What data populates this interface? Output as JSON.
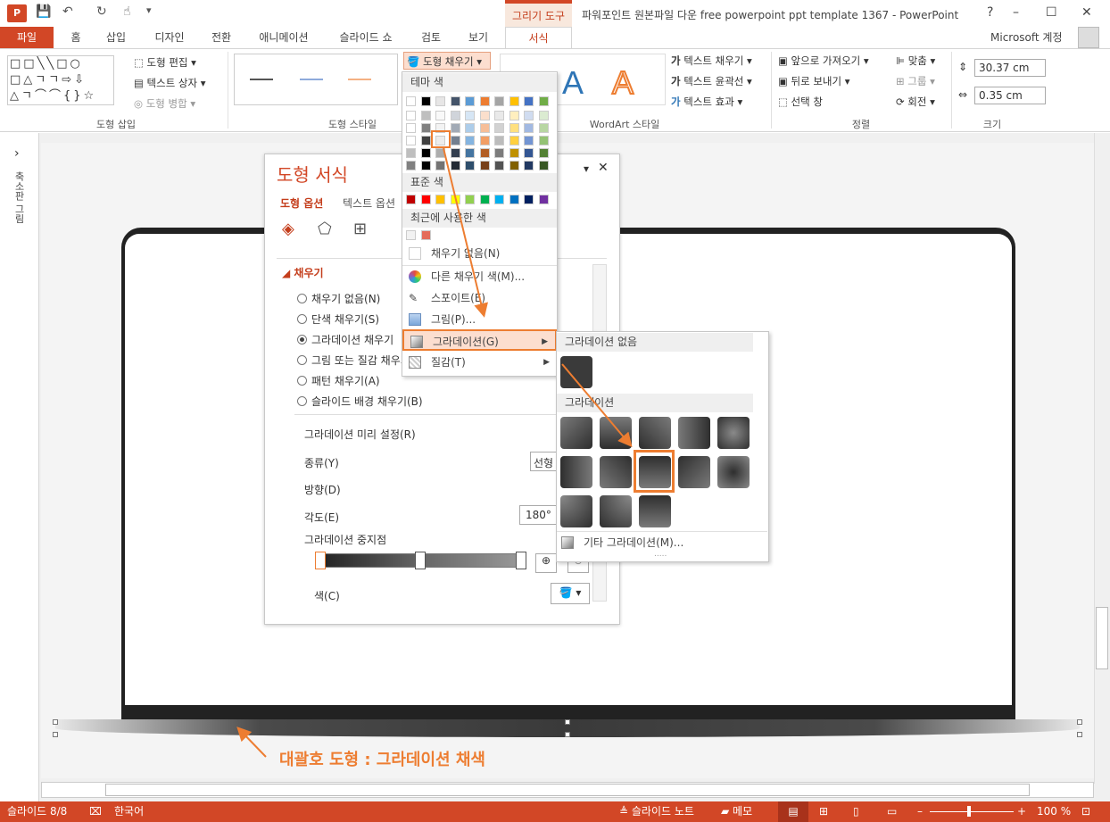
{
  "window": {
    "doc_title": "파워포인트 원본파일 다운 free powerpoint ppt template 1367 - PowerPoint",
    "context_tab": "그리기 도구",
    "help": "?",
    "minimize": "–",
    "restore": "☐",
    "close": "✕"
  },
  "qat": {
    "logo": "P",
    "save": "💾",
    "undo": "↶",
    "redo": "↻",
    "touch": "☝",
    "more": "▾"
  },
  "tabs": [
    "파일",
    "홈",
    "삽입",
    "디자인",
    "전환",
    "애니메이션",
    "슬라이드 쇼",
    "검토",
    "보기",
    "서식"
  ],
  "account": "Microsoft 계정",
  "ribbon": {
    "shapes_glyphs": "□□╲╲□○\n□△ㄱㄱ⇨⇩\n△ㄱ⌒⌒{}☆",
    "edit_shape": "도형 편집",
    "text_box": "텍스트 상자",
    "merge_shapes": "도형 병합",
    "group_insert": "도형 삽입",
    "group_style": "도형 스타일",
    "shape_fill": "도형 채우기",
    "text_fill": "텍스트 채우기",
    "text_outline": "텍스트 윤곽선",
    "text_effect": "텍스트 효과",
    "wordart_A": "A",
    "group_wordart": "WordArt 스타일",
    "bring_forward": "앞으로 가져오기",
    "send_backward": "뒤로 보내기",
    "selection_pane": "선택 창",
    "align": "맞춤",
    "group": "그룹",
    "rotate": "회전",
    "group_arrange": "정렬",
    "height": "30.37 cm",
    "width": "0.35 cm",
    "group_size": "크기"
  },
  "left_pane": {
    "label": "축소판 그림",
    "toggle": "›"
  },
  "format_pane": {
    "title": "도형 서식",
    "tab_shape": "도형 옵션",
    "tab_text": "텍스트 옵션",
    "section": "채우기",
    "options": [
      {
        "label": "채우기 없음(N)",
        "on": false
      },
      {
        "label": "단색 채우기(S)",
        "on": false
      },
      {
        "label": "그라데이션 채우기",
        "on": true
      },
      {
        "label": "그림 또는 질감 채우기",
        "on": false
      },
      {
        "label": "패턴 채우기(A)",
        "on": false
      },
      {
        "label": "슬라이드 배경 채우기(B)",
        "on": false
      }
    ],
    "preset_label": "그라데이션 미리 설정(R)",
    "type_label": "종류(Y)",
    "type_value": "선형",
    "direction_label": "방향(D)",
    "angle_label": "각도(E)",
    "angle_value": "180°",
    "stops_label": "그라데이션 중지점",
    "color_label": "색(C)"
  },
  "fill_menu": {
    "theme_colors": "테마 색",
    "standard_colors": "표준 색",
    "recent_colors": "최근에 사용한 색",
    "no_fill": "채우기 없음(N)",
    "more_colors": "다른 채우기 색(M)...",
    "eyedropper": "스포이트(E)",
    "picture": "그림(P)...",
    "gradient": "그라데이션(G)",
    "texture": "질감(T)",
    "theme_top": [
      "#ffffff",
      "#000000",
      "#e7e6e6",
      "#44546a",
      "#5b9bd5",
      "#ed7d31",
      "#a5a5a5",
      "#ffc000",
      "#4472c4",
      "#70ad47"
    ],
    "standard": [
      "#c00000",
      "#ff0000",
      "#ffc000",
      "#ffff00",
      "#92d050",
      "#00b050",
      "#00b0f0",
      "#0070c0",
      "#002060",
      "#7030a0"
    ],
    "recent": [
      "#f2f2f2",
      "#e46c5a"
    ]
  },
  "gradient_menu": {
    "no_gradient": "그라데이션 없음",
    "gradients": "그라데이션",
    "more": "기타 그라데이션(M)...",
    "dots": "....."
  },
  "slide": {
    "caption": "대괄호 도형 : 그라데이션 채색"
  },
  "status": {
    "slide": "슬라이드 8/8",
    "lang": "한국어",
    "notes": "슬라이드 노트",
    "comments": "메모",
    "zoom": "100 %"
  }
}
